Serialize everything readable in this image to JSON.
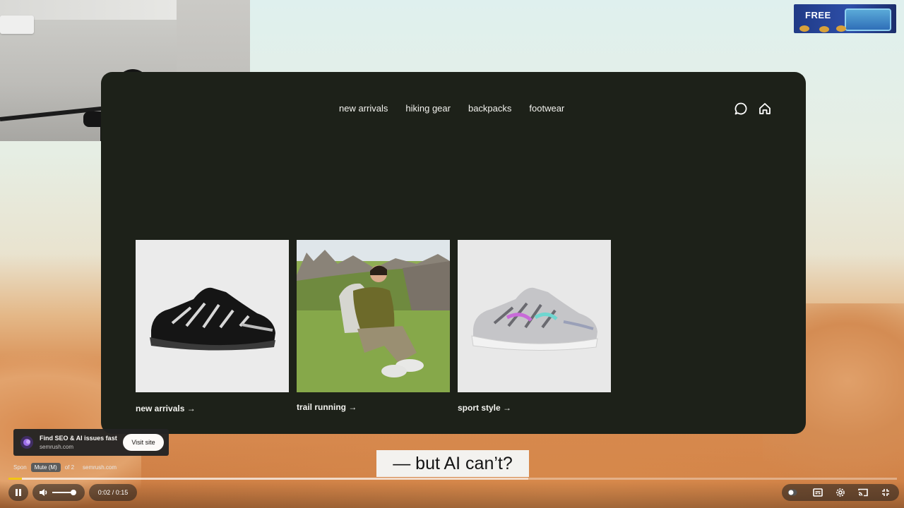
{
  "site": {
    "nav": [
      "new arrivals",
      "hiking gear",
      "backpacks",
      "footwear"
    ],
    "icons": [
      "chat-icon",
      "home-icon"
    ],
    "cards": [
      {
        "caption": "new arrivals →",
        "image": "black-shoe-image"
      },
      {
        "caption": "trail running →",
        "image": "hiker-photo"
      },
      {
        "caption": "sport style →",
        "image": "silver-shoe-image"
      }
    ]
  },
  "promo": {
    "text": "FREE"
  },
  "subtitle": "— but AI can’t?",
  "ad": {
    "title": "Find SEO & AI issues fast",
    "domain": "semrush.com",
    "visit": "Visit site",
    "sponsored_prefix": "Spon",
    "count_suffix": "of 2",
    "meta_domain": "semrush.com",
    "tooltip": "Mute (M)"
  },
  "player": {
    "time": "0:02 / 0:15",
    "progress": 0.015,
    "accent": "#f2c512"
  }
}
